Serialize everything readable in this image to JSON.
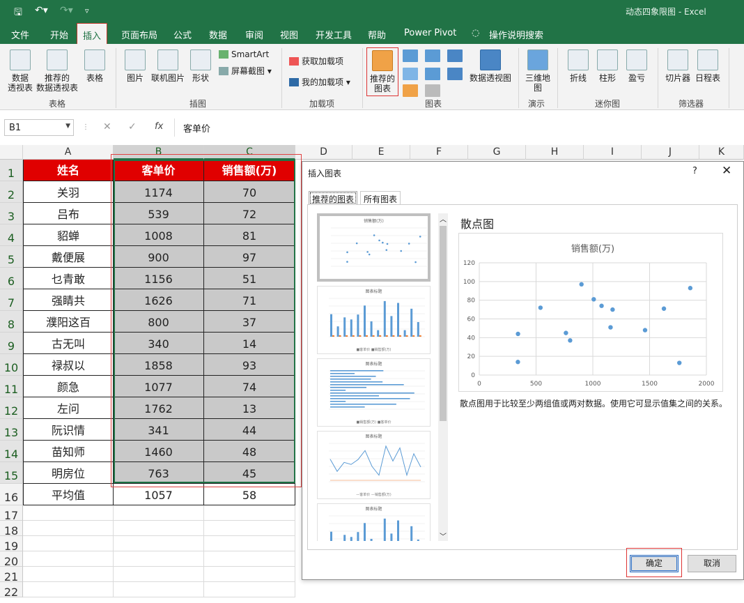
{
  "window": {
    "title": "动态四象限图  -  Excel"
  },
  "quick_access": {
    "save_icon": "save-icon",
    "undo_icon": "undo-icon",
    "redo_icon": "redo-icon",
    "more": "▿"
  },
  "menu": [
    "文件",
    "开始",
    "插入",
    "页面布局",
    "公式",
    "数据",
    "审阅",
    "视图",
    "开发工具",
    "帮助",
    "Power Pivot",
    "操作说明搜索"
  ],
  "menu_active": "插入",
  "ribbon": {
    "table_group": {
      "items": [
        "数据\n透视表",
        "推荐的\n数据透视表",
        "表格"
      ],
      "label": "表格"
    },
    "illus_group": {
      "items": [
        "图片",
        "联机图片",
        "形状"
      ],
      "smartart": "SmartArt",
      "screenshot": "屏幕截图",
      "label": "插图"
    },
    "addin_group": {
      "get": "获取加载项",
      "mine": "我的加载项",
      "label": "加载项"
    },
    "charts_group": {
      "recommended": "推荐的\n图表",
      "pivot": "数据透视图",
      "label": "图表"
    },
    "tour_group": {
      "map": "三维地\n图",
      "label": "演示"
    },
    "spark_group": {
      "items": [
        "折线",
        "柱形",
        "盈亏"
      ],
      "label": "迷你图"
    },
    "filter_group": {
      "items": [
        "切片器",
        "日程表"
      ],
      "label": "筛选器"
    }
  },
  "formula_bar": {
    "name_box": "B1",
    "fx": "fx",
    "value": "客单价"
  },
  "columns": [
    "A",
    "B",
    "C",
    "D",
    "E",
    "F",
    "G",
    "H",
    "I",
    "J",
    "K"
  ],
  "rows": [
    "1",
    "2",
    "3",
    "4",
    "5",
    "6",
    "7",
    "8",
    "9",
    "10",
    "11",
    "12",
    "13",
    "14",
    "15",
    "16",
    "17",
    "18",
    "19",
    "20",
    "21",
    "22"
  ],
  "table": {
    "headers": [
      "姓名",
      "客单价",
      "销售额(万)"
    ],
    "rows": [
      [
        "关羽",
        "1174",
        "70"
      ],
      [
        "吕布",
        "539",
        "72"
      ],
      [
        "貂蝉",
        "1008",
        "81"
      ],
      [
        "戴便展",
        "900",
        "97"
      ],
      [
        "乜青敢",
        "1156",
        "51"
      ],
      [
        "强睛共",
        "1626",
        "71"
      ],
      [
        "濮阳这百",
        "800",
        "37"
      ],
      [
        "古无叫",
        "340",
        "14"
      ],
      [
        "禄叔以",
        "1858",
        "93"
      ],
      [
        "颜急",
        "1077",
        "74"
      ],
      [
        "左问",
        "1762",
        "13"
      ],
      [
        "阮识情",
        "341",
        "44"
      ],
      [
        "苗知师",
        "1460",
        "48"
      ],
      [
        "明房位",
        "763",
        "45"
      ]
    ],
    "avg": [
      "平均值",
      "1057",
      "58"
    ]
  },
  "dialog": {
    "title": "插入图表",
    "help": "?",
    "close": "✕",
    "tabs": [
      "推荐的图表",
      "所有图表"
    ],
    "preview_title": "散点图",
    "description": "散点图用于比较至少两组值或两对数据。使用它可显示值集之间的关系。",
    "ok": "确定",
    "cancel": "取消",
    "thumb_titles": [
      "销售额(万)",
      "图表标题",
      "图表标题",
      "图表标题",
      "图表标题"
    ],
    "thumb_legends": [
      "",
      "■客单价 ■销售额(万)",
      "■销售额(万) ■客单价",
      "—客单价 —销售额(万)",
      ""
    ]
  },
  "chart_data": {
    "type": "scatter",
    "title": "销售额(万)",
    "x": [
      1174,
      539,
      1008,
      900,
      1156,
      1626,
      800,
      340,
      1858,
      1077,
      1762,
      341,
      1460,
      763
    ],
    "y": [
      70,
      72,
      81,
      97,
      51,
      71,
      37,
      14,
      93,
      74,
      13,
      44,
      48,
      45
    ],
    "xlim": [
      0,
      2000
    ],
    "ylim": [
      0,
      120
    ],
    "xticks": [
      0,
      500,
      1000,
      1500,
      2000
    ],
    "yticks": [
      0,
      20,
      40,
      60,
      80,
      100,
      120
    ],
    "grid": true,
    "color": "#5b9bd5"
  },
  "colors": {
    "accent": "#217346",
    "header_red": "#e00000",
    "data_grey": "#c9c9c9",
    "point_blue": "#5b9bd5"
  }
}
